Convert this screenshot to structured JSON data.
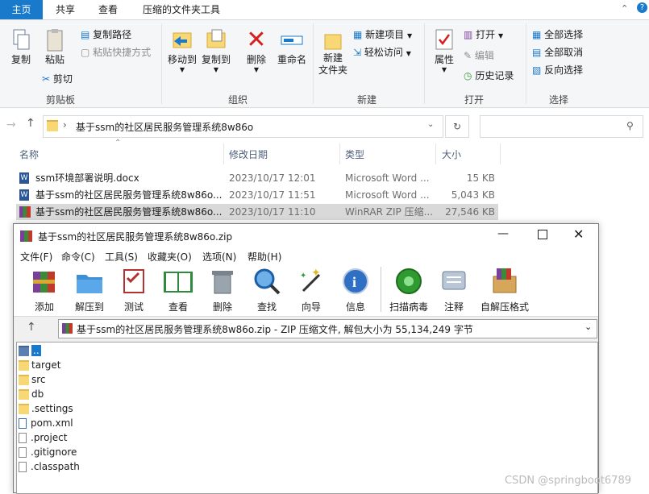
{
  "explorer": {
    "tabs": [
      "主页",
      "共享",
      "查看",
      "压缩的文件夹工具"
    ],
    "ribbon": {
      "clipboard": {
        "copy": "复制",
        "paste": "粘贴",
        "copy_path": "复制路径",
        "paste_shortcut": "粘贴快捷方式",
        "cut": "剪切",
        "label": "剪贴板"
      },
      "organize": {
        "move_to": "移动到",
        "copy_to": "复制到",
        "delete": "删除",
        "rename": "重命名",
        "label": "组织"
      },
      "new": {
        "new_folder": "新建\n文件夹",
        "new_item": "新建项目",
        "easy_access": "轻松访问",
        "label": "新建"
      },
      "open": {
        "properties": "属性",
        "open": "打开",
        "edit": "编辑",
        "history": "历史记录",
        "label": "打开"
      },
      "select": {
        "select_all": "全部选择",
        "select_none": "全部取消",
        "invert": "反向选择",
        "label": "选择"
      }
    },
    "address": "基于ssm的社区居民服务管理系统8w86o",
    "columns": {
      "name": "名称",
      "date": "修改日期",
      "type": "类型",
      "size": "大小"
    },
    "files": [
      {
        "name": "ssm环境部署说明.docx",
        "date": "2023/10/17 12:01",
        "type": "Microsoft Word ...",
        "size": "15 KB"
      },
      {
        "name": "基于ssm的社区居民服务管理系统8w86o...",
        "date": "2023/10/17 11:51",
        "type": "Microsoft Word ...",
        "size": "5,043 KB"
      },
      {
        "name": "基于ssm的社区居民服务管理系统8w86o...",
        "date": "2023/10/17 11:10",
        "type": "WinRAR ZIP 压缩...",
        "size": "27,546 KB"
      }
    ]
  },
  "winrar": {
    "title": "基于ssm的社区居民服务管理系统8w86o.zip",
    "menu": [
      "文件(F)",
      "命令(C)",
      "工具(S)",
      "收藏夹(O)",
      "选项(N)",
      "帮助(H)"
    ],
    "toolbar": [
      "添加",
      "解压到",
      "测试",
      "查看",
      "删除",
      "查找",
      "向导",
      "信息",
      "扫描病毒",
      "注释",
      "自解压格式"
    ],
    "path": "基于ssm的社区居民服务管理系统8w86o.zip - ZIP 压缩文件, 解包大小为 55,134,249 字节",
    "items": [
      "..",
      "target",
      "src",
      "db",
      ".settings",
      "pom.xml",
      ".project",
      ".gitignore",
      ".classpath"
    ]
  },
  "watermark": "CSDN @springboot6789"
}
